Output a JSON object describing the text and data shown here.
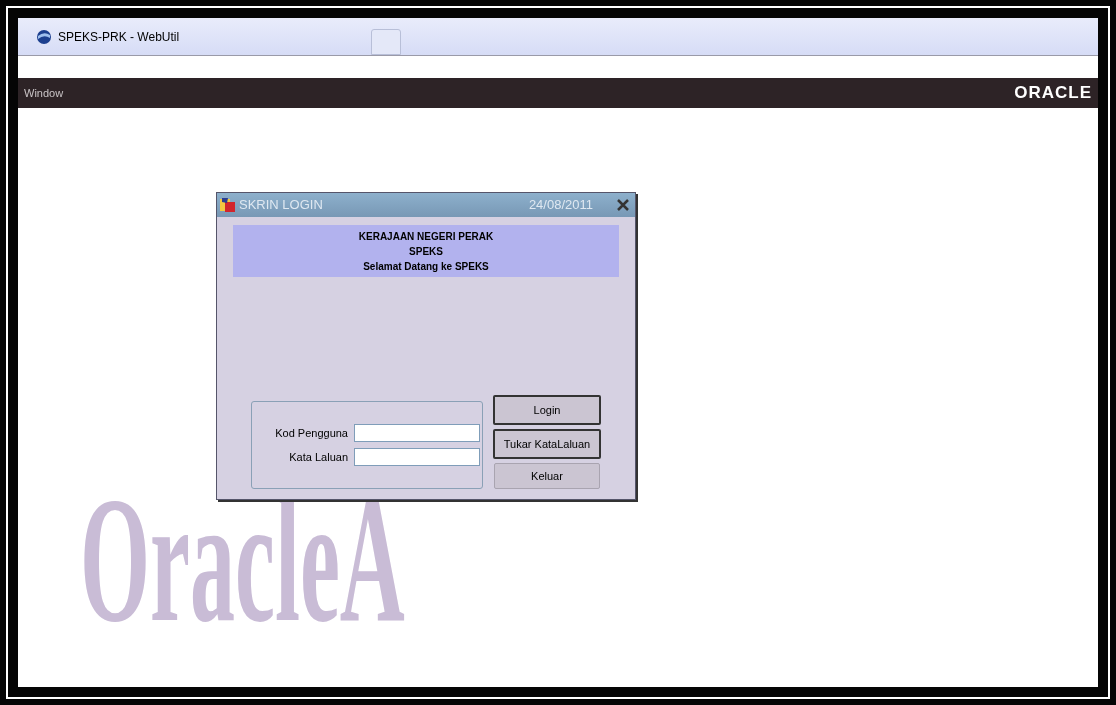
{
  "browser": {
    "title": "SPEKS-PRK - WebUtil"
  },
  "menu_bar": {
    "items": [
      {
        "label": "Window"
      }
    ],
    "brand": "ORACLE"
  },
  "background_logo": "OracleA",
  "dialog": {
    "title": "SKRIN LOGIN",
    "date": "24/08/2011",
    "banner": [
      "KERAJAAN NEGERI PERAK",
      "SPEKS",
      "Selamat Datang ke SPEKS"
    ],
    "fields": [
      {
        "label": "Kod Pengguna"
      },
      {
        "label": "Kata Laluan"
      }
    ],
    "buttons": [
      {
        "label": "Login",
        "default": true
      },
      {
        "label": "Tukar KataLaluan",
        "default": true
      },
      {
        "label": "Keluar",
        "default": false
      }
    ]
  }
}
